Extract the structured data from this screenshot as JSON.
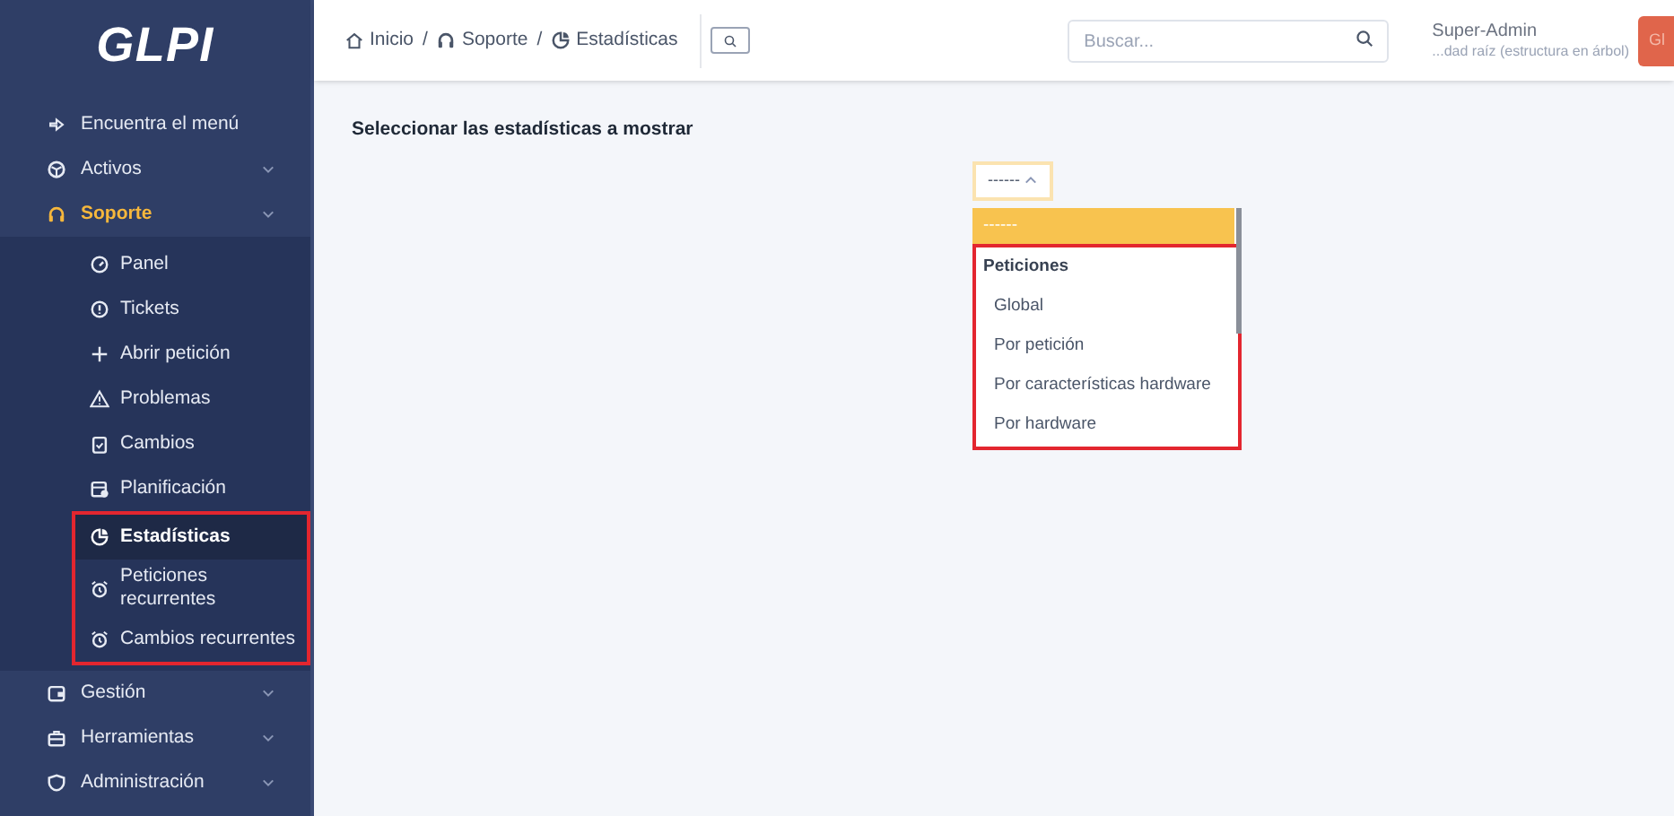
{
  "sidebar": {
    "logo": "GLPI",
    "items": [
      {
        "label": "Encuentra el menú"
      },
      {
        "label": "Activos",
        "expanded": false
      },
      {
        "label": "Soporte",
        "expanded": true,
        "children": [
          {
            "label": "Panel",
            "selected": false,
            "framed": false
          },
          {
            "label": "Tickets",
            "selected": false,
            "framed": false
          },
          {
            "label": "Abrir petición",
            "selected": false,
            "framed": false
          },
          {
            "label": "Problemas",
            "selected": false,
            "framed": false
          },
          {
            "label": "Cambios",
            "selected": false,
            "framed": false
          },
          {
            "label": "Planificación",
            "selected": false,
            "framed": false
          },
          {
            "label": "Estadísticas",
            "selected": true,
            "framed": true
          },
          {
            "label": "Peticiones recurrentes",
            "selected": false,
            "framed": true
          },
          {
            "label": "Cambios recurrentes",
            "selected": false,
            "framed": true
          }
        ]
      },
      {
        "label": "Gestión",
        "expanded": false
      },
      {
        "label": "Herramientas",
        "expanded": false
      },
      {
        "label": "Administración",
        "expanded": false
      }
    ]
  },
  "header": {
    "breadcrumbs": [
      {
        "kind": "link",
        "label": "Inicio"
      },
      {
        "kind": "separator",
        "label": "/"
      },
      {
        "kind": "link",
        "label": "Soporte"
      },
      {
        "kind": "separator",
        "label": "/"
      },
      {
        "kind": "link",
        "label": "Estadísticas"
      }
    ],
    "search": {
      "placeholder": "Buscar..."
    },
    "user": {
      "name": "Super-Admin",
      "entity": "...dad raíz (estructura en árbol)"
    },
    "button": "Gl"
  },
  "content": {
    "title": "Seleccionar las estadísticas a mostrar",
    "select": {
      "value": "------",
      "open": true
    },
    "dropdown": {
      "options": [
        {
          "label": "------",
          "selected": true
        }
      ],
      "groups": [
        {
          "label": "Peticiones",
          "framed": true,
          "options": [
            {
              "label": "Global",
              "selected": false
            },
            {
              "label": "Por petición",
              "selected": false
            },
            {
              "label": "Por características hardware",
              "selected": false
            },
            {
              "label": "Por hardware",
              "selected": false
            }
          ]
        }
      ]
    }
  }
}
